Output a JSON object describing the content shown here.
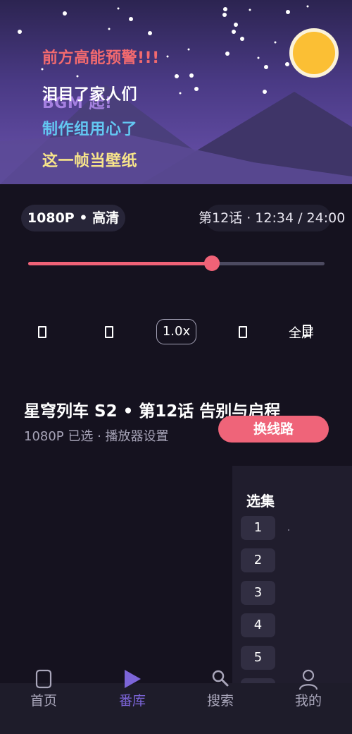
{
  "player": {
    "danmaku": [
      {
        "text": "前方高能预警!!!",
        "color": "#f26a6f"
      },
      {
        "text": "BGM 起!",
        "color": "#b48cf0"
      },
      {
        "text": "泪目了家人们",
        "color": "#ffffff"
      },
      {
        "text": "制作组用心了",
        "color": "#63c7f2"
      },
      {
        "text": "这一帧当壁纸",
        "color": "#f7e48a"
      }
    ],
    "quality_badge": "1080P • 高清",
    "episode_time": "第12话 · 12:34 / 24:00",
    "progress": 0.62,
    "speed_label": "1.0x",
    "fullscreen_label": "全屏"
  },
  "episode": {
    "title": "星穹列车 S2 • 第12话 告别与启程",
    "subtitle": "1080P 已选 · 播放器设置",
    "switch_line_label": "换线路"
  },
  "episode_panel": {
    "title": "选集",
    "episodes": [
      "1",
      "2",
      "3",
      "4",
      "5"
    ]
  },
  "bottom_nav": {
    "items": [
      {
        "label": "首页",
        "icon": "phone-icon",
        "active": false
      },
      {
        "label": "番库",
        "icon": "play-icon",
        "active": true
      },
      {
        "label": "搜索",
        "icon": "search-icon",
        "active": false
      },
      {
        "label": "我的",
        "icon": "user-icon",
        "active": false
      }
    ]
  },
  "colors": {
    "accent": "#ef6479",
    "nav_active": "#7c65d8",
    "background": "#15121f"
  }
}
